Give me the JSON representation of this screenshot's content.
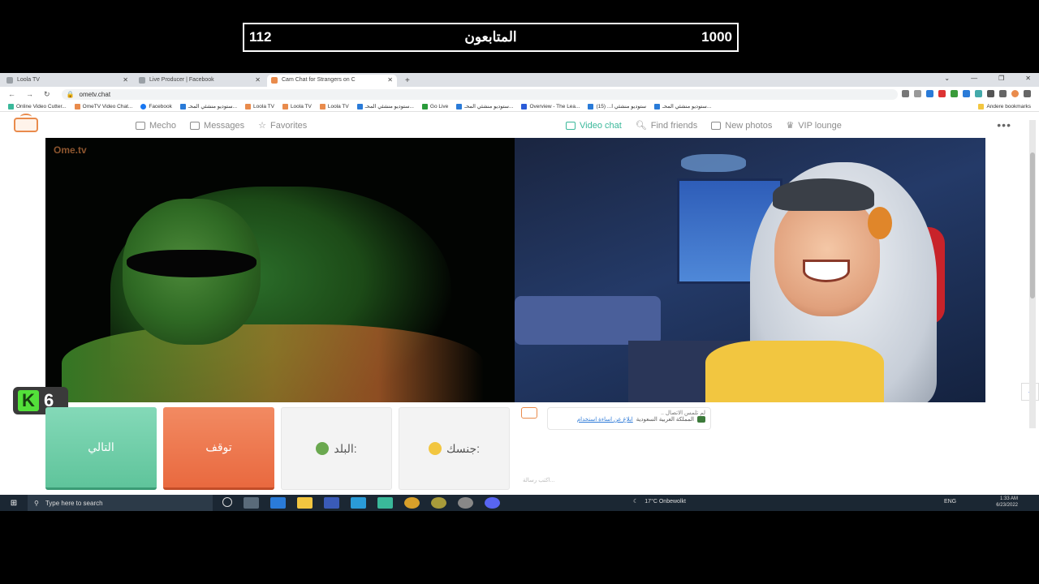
{
  "overlay": {
    "followers_label": "المتابعون",
    "left_count": "112",
    "right_count": "1000"
  },
  "browser": {
    "tabs": [
      {
        "label": "Loola TV",
        "active": false
      },
      {
        "label": "Live Producer | Facebook",
        "active": false
      },
      {
        "label": "Cam Chat for Strangers on C",
        "active": true
      }
    ],
    "new_tab": "+",
    "url": "ometv.chat",
    "bookmarks": [
      "Online Video Cutter...",
      "OmeTV Video Chat...",
      "Facebook",
      "ستوديو منشئي المحـ...",
      "Loola TV",
      "Loola TV",
      "Loola TV",
      "ستوديو منشئي المحـ...",
      "Go Live",
      "ستوديو منشئي المحـ...",
      "Overview - The Lea...",
      "ستوديو منشئي ا... (15)",
      "ستوديو منشئي المحـ..."
    ],
    "bookmarks_right": "Andere bookmarks"
  },
  "ome": {
    "nav_left": [
      {
        "label": "Mecho",
        "icon": "lock-icon"
      },
      {
        "label": "Messages",
        "icon": "mail-icon"
      },
      {
        "label": "Favorites",
        "icon": "star-icon"
      }
    ],
    "nav_right": [
      {
        "label": "Video chat",
        "icon": "video-icon",
        "active": true
      },
      {
        "label": "Find friends",
        "icon": "search-icon"
      },
      {
        "label": "New photos",
        "icon": "photo-icon"
      },
      {
        "label": "VIP lounge",
        "icon": "vip-icon"
      }
    ],
    "more": "•••",
    "watermark": "Ome.tv",
    "accent": "#3ab89a",
    "stop_color": "#e9693f"
  },
  "badge": {
    "letter": "K",
    "count": "6"
  },
  "controls": {
    "next": "التالي",
    "stop": "توقف",
    "country": "البلد:",
    "gender": "جنسك:"
  },
  "chat": {
    "line1": "لم تلمس الاتصال ..",
    "line2_link": "ابلاغ عن اساءة استخدام",
    "line2_text": "المملكة العربية السعودية",
    "input_placeholder": "اكتب رسالة..."
  },
  "taskbar": {
    "search_placeholder": "Type here to search",
    "weather": "17°C Onbewolkt",
    "lang": "ENG",
    "time": "1:33 AM",
    "date": "6/23/2022"
  }
}
